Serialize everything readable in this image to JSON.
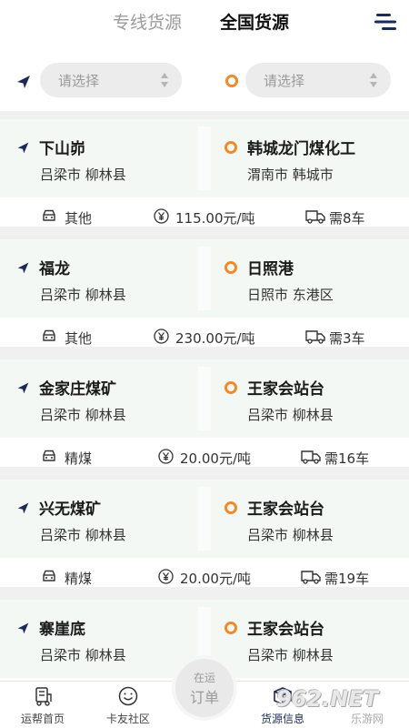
{
  "header": {
    "tabs": [
      {
        "label": "专线货源",
        "active": false
      },
      {
        "label": "全国货源",
        "active": true
      }
    ],
    "menu_icon": "hamburger-menu-icon"
  },
  "filters": {
    "origin_placeholder": "请选择",
    "destination_placeholder": "请选择"
  },
  "colors": {
    "accent_navy": "#1c2a55",
    "origin_orange": "#f08a2c",
    "route_bg": "#f4f8f5"
  },
  "cards": [
    {
      "from": "下山峁",
      "from_loc": "吕梁市 柳林县",
      "to": "韩城龙门煤化工",
      "to_loc": "渭南市 韩城市",
      "cargo": "其他",
      "price": "115.00元/吨",
      "trucks": "需8车"
    },
    {
      "from": "福龙",
      "from_loc": "吕梁市 柳林县",
      "to": "日照港",
      "to_loc": "日照市 东港区",
      "cargo": "其他",
      "price": "230.00元/吨",
      "trucks": "需3车"
    },
    {
      "from": "金家庄煤矿",
      "from_loc": "吕梁市 柳林县",
      "to": "王家会站台",
      "to_loc": "吕梁市 柳林县",
      "cargo": "精煤",
      "price": "20.00元/吨",
      "trucks": "需16车"
    },
    {
      "from": "兴无煤矿",
      "from_loc": "吕梁市 柳林县",
      "to": "王家会站台",
      "to_loc": "吕梁市 柳林县",
      "cargo": "精煤",
      "price": "20.00元/吨",
      "trucks": "需19车"
    },
    {
      "from": "寨崖底",
      "from_loc": "吕梁市 柳林县",
      "to": "王家会站台",
      "to_loc": "吕梁市 柳林县"
    }
  ],
  "nav": {
    "items": [
      {
        "label": "运帮首页",
        "icon": "truck-order-icon"
      },
      {
        "label": "卡友社区",
        "icon": "smiley-icon"
      },
      {
        "label": "货源信息",
        "icon": "cargo-box-icon"
      }
    ],
    "center_line1": "在运",
    "center_line2": "订单"
  },
  "watermark": {
    "logo": "962.NET",
    "sub": "乐游网"
  }
}
